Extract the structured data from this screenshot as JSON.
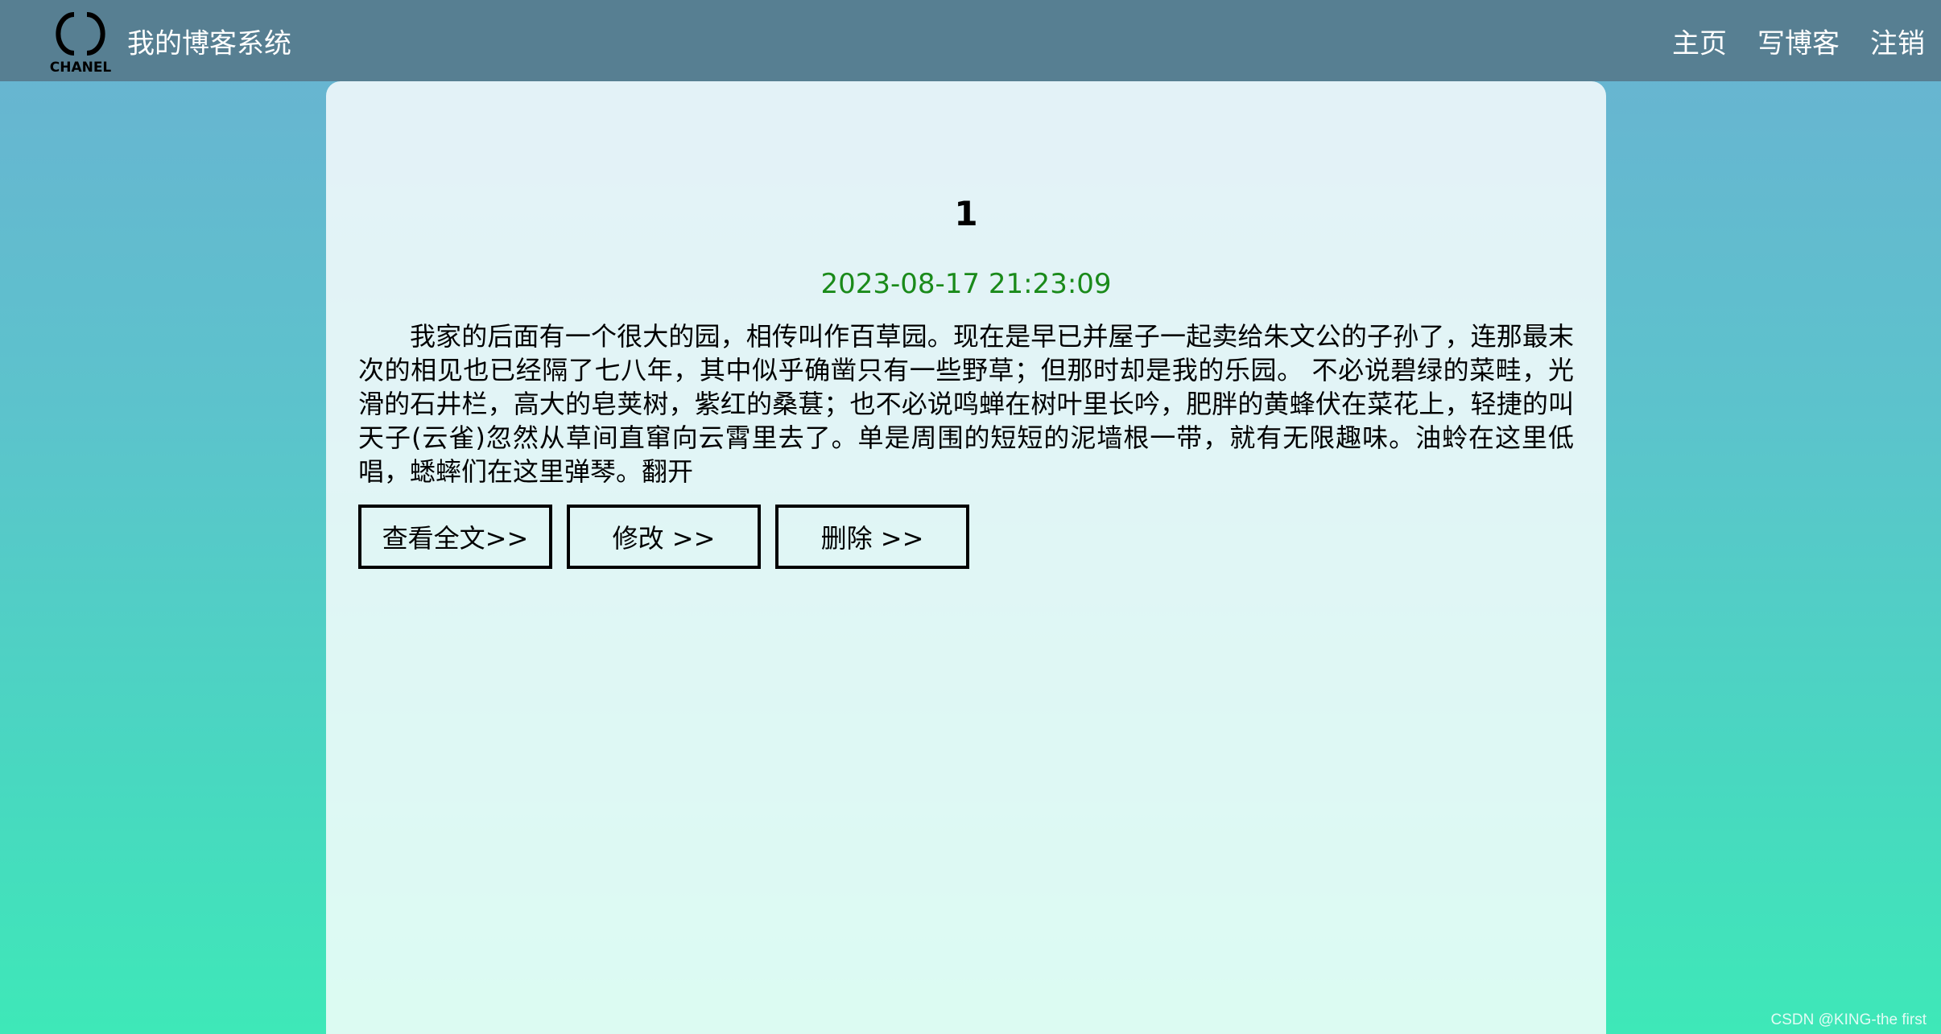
{
  "header": {
    "logo_text": "CHANEL",
    "site_title": "我的博客系统",
    "nav": [
      "主页",
      "写博客",
      "注销"
    ]
  },
  "blog": {
    "title": "1",
    "date": "2023-08-17 21:23:09",
    "desc": "我家的后面有一个很大的园，相传叫作百草园。现在是早已并屋子一起卖给朱文公的子孙了，连那最末次的相见也已经隔了七八年，其中似乎确凿只有一些野草；但那时却是我的乐园。 不必说碧绿的菜畦，光滑的石井栏，高大的皂荚树，紫红的桑葚；也不必说鸣蝉在树叶里长吟，肥胖的黄蜂伏在菜花上，轻捷的叫天子(云雀)忽然从草间直窜向云霄里去了。单是周围的短短的泥墙根一带，就有无限趣味。油蛉在这里低唱，蟋蟀们在这里弹琴。翻开",
    "buttons": {
      "view": "查看全文>>",
      "edit": "修改 >>",
      "delete": "删除 >>"
    }
  },
  "watermark": "CSDN @KING-the first",
  "colors": {
    "navbar": "#577f92",
    "date": "#1a8a1a"
  }
}
